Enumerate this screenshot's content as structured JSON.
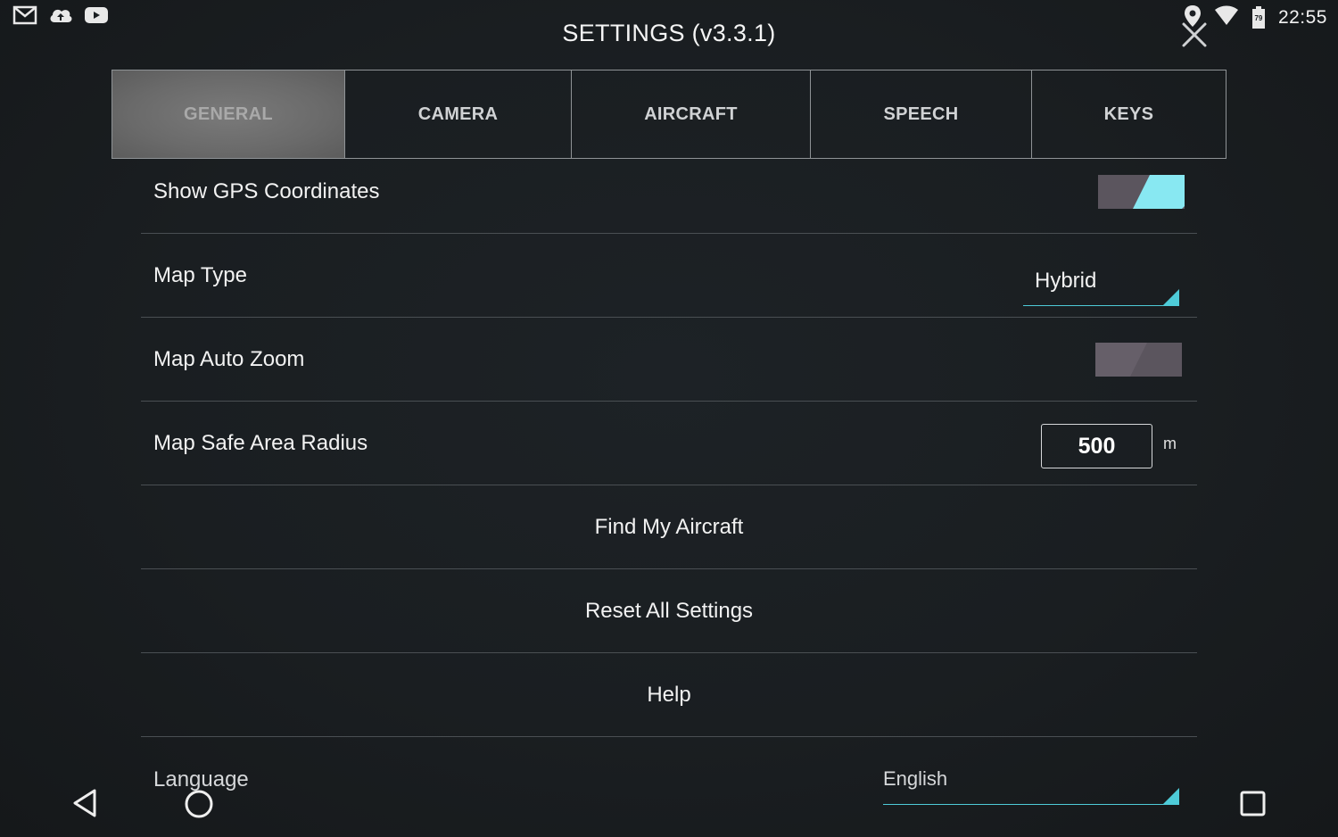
{
  "status_bar": {
    "left_icons": [
      "gmail-icon",
      "cloud-upload-icon",
      "youtube-icon"
    ],
    "right_icons": [
      "location-pin-icon",
      "wifi-icon",
      "battery-icon"
    ],
    "battery_level": "79",
    "time": "22:55"
  },
  "title": "SETTINGS (v3.3.1)",
  "tabs": [
    {
      "label": "GENERAL",
      "active": true
    },
    {
      "label": "CAMERA",
      "active": false
    },
    {
      "label": "AIRCRAFT",
      "active": false
    },
    {
      "label": "SPEECH",
      "active": false
    },
    {
      "label": "KEYS",
      "active": false
    }
  ],
  "settings": {
    "show_gps": {
      "label": "Show GPS Coordinates",
      "enabled": true
    },
    "map_type": {
      "label": "Map Type",
      "value": "Hybrid"
    },
    "map_auto_zoom": {
      "label": "Map Auto Zoom",
      "enabled": false
    },
    "safe_radius": {
      "label": "Map Safe Area Radius",
      "value": "500",
      "unit": "m"
    },
    "find_aircraft": {
      "label": "Find My Aircraft"
    },
    "reset_all": {
      "label": "Reset All Settings"
    },
    "help": {
      "label": "Help"
    },
    "language": {
      "label": "Language",
      "value": "English"
    }
  },
  "nav_bar": {
    "icons": [
      "back-icon",
      "home-icon",
      "recents-icon"
    ]
  },
  "colors": {
    "accent": "#4ecbd8",
    "toggle_on": "#88e8f2",
    "toggle_off": "#5b555e",
    "background": "#1a1e21"
  }
}
